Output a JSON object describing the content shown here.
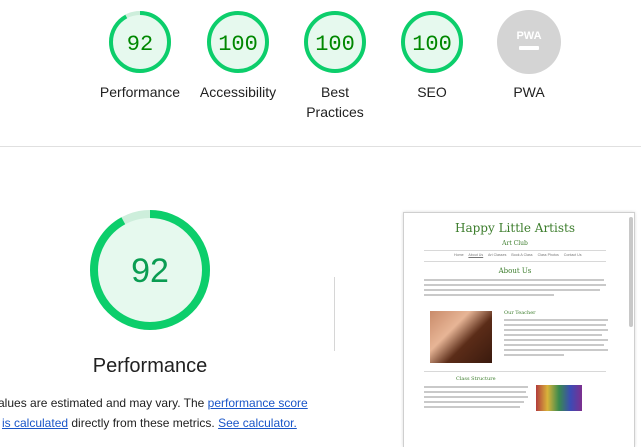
{
  "scores": [
    {
      "value": "92",
      "label": "Performance",
      "score": 0.92
    },
    {
      "value": "100",
      "label": "Accessibility",
      "score": 1.0
    },
    {
      "value": "100",
      "label": "Best Practices",
      "score": 1.0
    },
    {
      "value": "100",
      "label": "SEO",
      "score": 1.0
    },
    {
      "value": "PWA",
      "label": "PWA",
      "score": null
    }
  ],
  "main_score": {
    "value": "92",
    "label": "Performance",
    "score": 0.92
  },
  "note": {
    "text_1": "alues are estimated and may vary. The ",
    "link_1": "performance score",
    "link_2": "is calculated",
    "text_2": " directly from these metrics. ",
    "link_3": "See calculator."
  },
  "thumbnail": {
    "site_title": "Happy Little Artists",
    "site_subtitle": "Art Club",
    "nav": [
      "Home",
      "About Us",
      "Art Classes",
      "Book A Class",
      "Class Photos",
      "Contact Us"
    ],
    "section_about": "About Us",
    "section_teacher": "Our Teacher",
    "section_structure": "Class Structure"
  },
  "colors": {
    "pass_green": "#0cce6b",
    "pass_fill": "#e6f9ee",
    "pass_text": "#008800",
    "pwa_gray": "#d4d4d4"
  }
}
